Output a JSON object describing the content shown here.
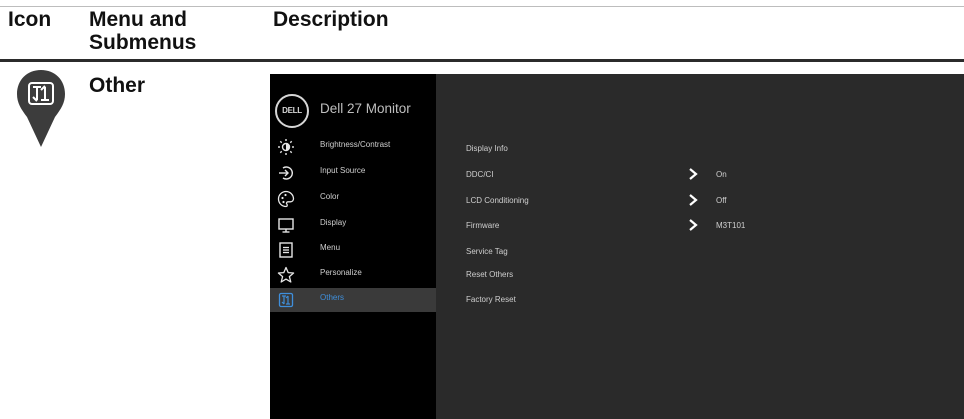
{
  "header": {
    "icon_col": "Icon",
    "menu_col": "Menu and Submenus",
    "desc_col": "Description"
  },
  "row": {
    "title": "Other",
    "icon": "others-pin-icon"
  },
  "osd": {
    "logo_text": "DELL",
    "monitor_name": "Dell 27 Monitor",
    "menu": [
      {
        "label": "Brightness/Contrast",
        "icon": "brightness-icon"
      },
      {
        "label": "Input Source",
        "icon": "input-source-icon"
      },
      {
        "label": "Color",
        "icon": "color-palette-icon"
      },
      {
        "label": "Display",
        "icon": "display-icon"
      },
      {
        "label": "Menu",
        "icon": "menu-icon"
      },
      {
        "label": "Personalize",
        "icon": "star-icon"
      },
      {
        "label": "Others",
        "icon": "others-icon",
        "selected": true
      }
    ],
    "submenu": [
      {
        "label": "Display Info",
        "value": ""
      },
      {
        "label": "DDC/CI",
        "value": "On"
      },
      {
        "label": "LCD Conditioning",
        "value": "Off"
      },
      {
        "label": "Firmware",
        "value": "M3T101"
      },
      {
        "label": "Service Tag",
        "value": ""
      },
      {
        "label": "Reset Others",
        "value": ""
      },
      {
        "label": "Factory Reset",
        "value": ""
      }
    ],
    "colors": {
      "selected_text": "#3f8fdb",
      "left_panel": "#000000",
      "right_panel": "#2a2a2a"
    }
  }
}
